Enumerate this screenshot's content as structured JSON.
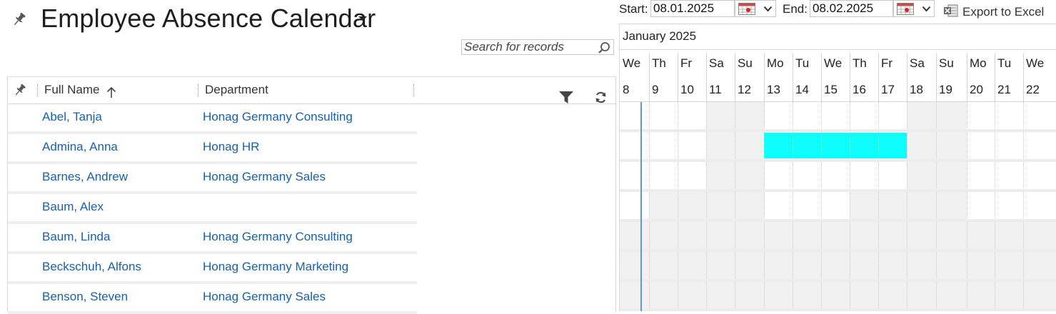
{
  "page": {
    "title": "Employee Absence Calendar",
    "search_placeholder": "Search for records"
  },
  "grid": {
    "columns": [
      {
        "label": "Full Name",
        "sort": "ascending"
      },
      {
        "label": "Department"
      }
    ],
    "rows": [
      {
        "name": "Abel, Tanja",
        "department": "Honag Germany Consulting"
      },
      {
        "name": "Admina, Anna",
        "department": "Honag HR"
      },
      {
        "name": "Barnes, Andrew",
        "department": "Honag Germany Sales"
      },
      {
        "name": "Baum, Alex",
        "department": ""
      },
      {
        "name": "Baum, Linda",
        "department": "Honag Germany Consulting"
      },
      {
        "name": "Beckschuh, Alfons",
        "department": "Honag Germany Marketing"
      },
      {
        "name": "Benson, Steven",
        "department": "Honag Germany Sales"
      }
    ]
  },
  "toolbar": {
    "start_label": "Start:",
    "start_value": "08.01.2025",
    "end_label": "End:",
    "end_value": "08.02.2025",
    "export_label": "Export to Excel"
  },
  "calendar": {
    "month": "January 2025",
    "days": [
      {
        "dow": "We",
        "num": "8"
      },
      {
        "dow": "Th",
        "num": "9"
      },
      {
        "dow": "Fr",
        "num": "10"
      },
      {
        "dow": "Sa",
        "num": "11"
      },
      {
        "dow": "Su",
        "num": "12"
      },
      {
        "dow": "Mo",
        "num": "13"
      },
      {
        "dow": "Tu",
        "num": "14"
      },
      {
        "dow": "We",
        "num": "15"
      },
      {
        "dow": "Th",
        "num": "16"
      },
      {
        "dow": "Fr",
        "num": "17"
      },
      {
        "dow": "Sa",
        "num": "18"
      },
      {
        "dow": "Su",
        "num": "19"
      },
      {
        "dow": "Mo",
        "num": "20"
      },
      {
        "dow": "Tu",
        "num": "21"
      },
      {
        "dow": "We",
        "num": "22"
      }
    ],
    "absence_color": "#10fdfd",
    "weekend_color": "#f0f0f0",
    "today_line_color": "#5b9bd5"
  }
}
